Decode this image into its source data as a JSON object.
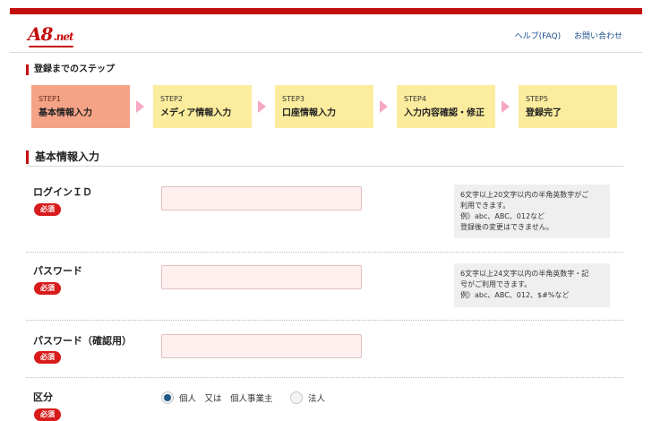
{
  "header": {
    "logo_main": "A8",
    "logo_net": ".net",
    "links": [
      "ヘルプ(FAQ)",
      "お問い合わせ"
    ]
  },
  "steps_title": "登録までのステップ",
  "steps": [
    {
      "num": "STEP1",
      "label": "基本情報入力",
      "active": true
    },
    {
      "num": "STEP2",
      "label": "メディア情報入力",
      "active": false
    },
    {
      "num": "STEP3",
      "label": "口座情報入力",
      "active": false
    },
    {
      "num": "STEP4",
      "label": "入力内容確認・修正",
      "active": false
    },
    {
      "num": "STEP5",
      "label": "登録完了",
      "active": false
    }
  ],
  "section_title": "基本情報入力",
  "required_badge": "必須",
  "fields": {
    "login_id": {
      "label": "ログインＩＤ",
      "value": "",
      "note": [
        "6文字以上20文字以内の半角英数字がご",
        "利用できます。",
        "例）abc、ABC、012など",
        "登録後の変更はできません。"
      ]
    },
    "password": {
      "label": "パスワード",
      "value": "",
      "note": [
        "6文字以上24文字以内の半角英数字・記",
        "号がご利用できます。",
        "例）abc、ABC、012、$#%など"
      ]
    },
    "password_confirm": {
      "label": "パスワード（確認用）",
      "value": ""
    },
    "category": {
      "label": "区分",
      "options": [
        "個人　又は　個人事業主",
        "法人"
      ],
      "selected": 0
    }
  },
  "colors": {
    "brand_red": "#c40f0f",
    "step_active": "#f5a386",
    "step_inactive": "#fcec9d",
    "required_badge": "#d81b1b",
    "input_bg": "#fff0f0"
  }
}
